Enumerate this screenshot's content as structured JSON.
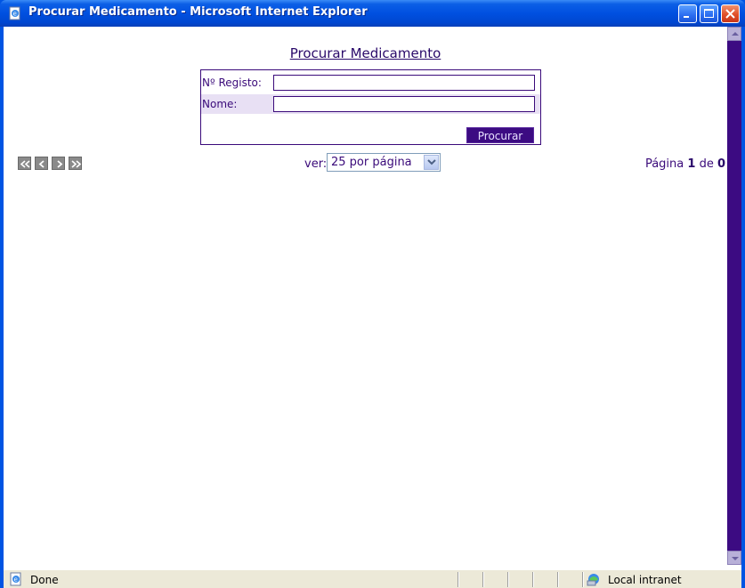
{
  "window": {
    "title": "Procurar Medicamento - Microsoft Internet Explorer"
  },
  "page": {
    "title": "Procurar Medicamento",
    "form": {
      "registo_label": "Nº Registo:",
      "registo_value": "",
      "nome_label": "Nome:",
      "nome_value": "",
      "search_button": "Procurar"
    },
    "pager": {
      "ver_label": "ver:",
      "per_page_selected": "25 por página",
      "page_prefix": "Página",
      "current_page": "1",
      "page_of": "de",
      "total_pages": "0"
    }
  },
  "status": {
    "text": "Done",
    "zone": "Local intranet"
  },
  "icons": [
    "ie-page-icon",
    "first-page-icon",
    "prev-page-icon",
    "next-page-icon",
    "last-page-icon",
    "dropdown-arrow-icon",
    "ie-status-icon",
    "local-intranet-icon"
  ],
  "colors": {
    "accent": "#3c0b82",
    "titlebar": "#0054e3",
    "text": "#3a0a7a"
  }
}
